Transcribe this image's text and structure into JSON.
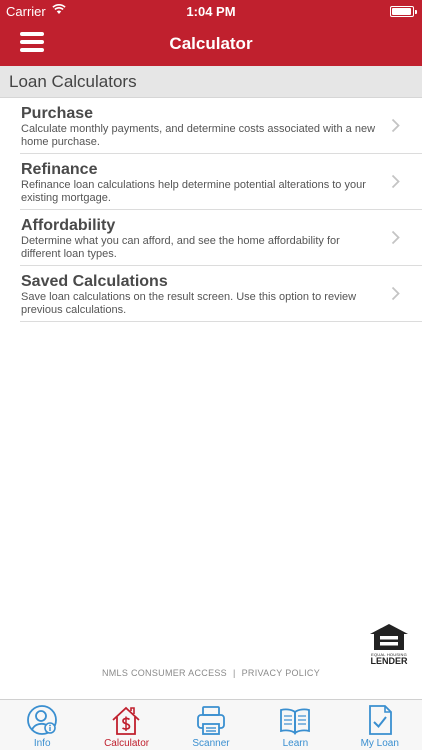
{
  "status_bar": {
    "carrier": "Carrier",
    "time": "1:04 PM"
  },
  "nav": {
    "title": "Calculator"
  },
  "section": {
    "header": "Loan Calculators"
  },
  "items": [
    {
      "title": "Purchase",
      "description": "Calculate monthly payments, and determine costs associated with a new home purchase."
    },
    {
      "title": "Refinance",
      "description": "Refinance loan calculations help determine potential alterations to your existing mortgage."
    },
    {
      "title": "Affordability",
      "description": "Determine what you can afford, and see the home affordability for different loan types."
    },
    {
      "title": "Saved Calculations",
      "description": "Save loan calculations on the result screen. Use this option to review previous calculations."
    }
  ],
  "logo": {
    "line1": "EQUAL HOUSING",
    "line2": "LENDER"
  },
  "footer": {
    "nmls": "NMLS CONSUMER ACCESS",
    "separator": "|",
    "privacy": "PRIVACY POLICY"
  },
  "tabs": [
    {
      "label": "Info",
      "icon": "info-user-icon"
    },
    {
      "label": "Calculator",
      "icon": "house-dollar-icon",
      "active": true
    },
    {
      "label": "Scanner",
      "icon": "scanner-icon"
    },
    {
      "label": "Learn",
      "icon": "book-icon"
    },
    {
      "label": "My Loan",
      "icon": "document-check-icon"
    }
  ],
  "colors": {
    "brand": "#c0202e",
    "tab_inactive": "#3a8fd0",
    "header_bg": "#e6e6e6"
  }
}
